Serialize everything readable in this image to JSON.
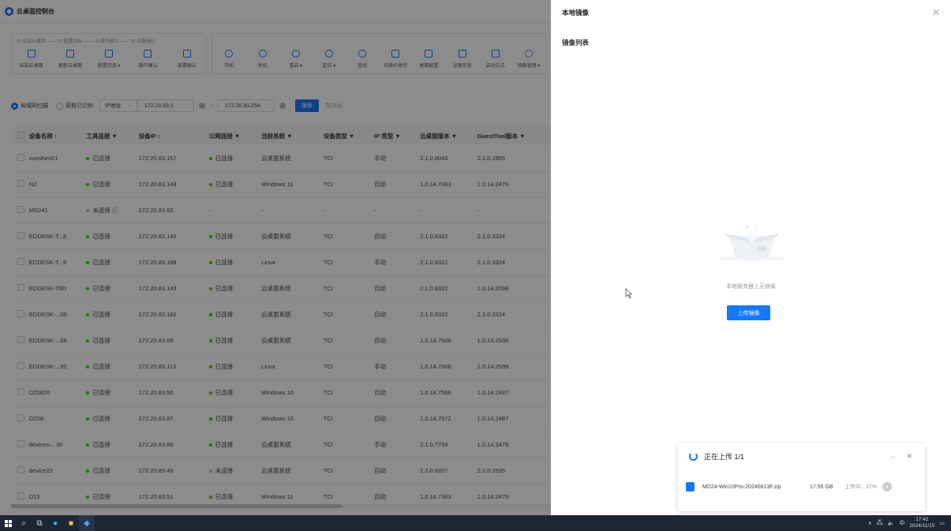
{
  "app": {
    "title": "云桌面控制台"
  },
  "steps": "① 安装云桌面 —— ② 配置目标 —— ③ 操作确认 —— ④ 部署确认",
  "toolbar": [
    {
      "label": "安装云桌面",
      "icon": "install-icon"
    },
    {
      "label": "更新云桌面",
      "icon": "update-icon"
    },
    {
      "label": "配置信息 ▾",
      "icon": "config-icon"
    },
    {
      "label": "操作确认",
      "icon": "confirm-icon"
    },
    {
      "label": "部署确认",
      "icon": "deploy-icon"
    },
    {
      "label": "开机",
      "icon": "power-on-icon"
    },
    {
      "label": "关机",
      "icon": "power-off-icon"
    },
    {
      "label": "重启 ▾",
      "icon": "restart-icon"
    },
    {
      "label": "定位 ▾",
      "icon": "locate-icon"
    },
    {
      "label": "查找",
      "icon": "search-icon"
    },
    {
      "label": "切换IP类型",
      "icon": "switch-ip-icon"
    },
    {
      "label": "桌面配置",
      "icon": "desktop-config-icon"
    },
    {
      "label": "设备信息",
      "icon": "device-info-icon"
    },
    {
      "label": "启动方式",
      "icon": "boot-mode-icon"
    },
    {
      "label": "镜像管理 ▾",
      "icon": "image-manage-icon"
    }
  ],
  "filter": {
    "radio1": "局域网扫描",
    "radio2": "获取已识别",
    "select": "IP地址",
    "from": "172.20.83.1",
    "sep": "~",
    "to": "172.20.83.254",
    "search": "搜索",
    "count": "共15台"
  },
  "table": {
    "headers": [
      "设备名称 ↕",
      "工具连接 ▼",
      "设备IP ↕",
      "公网连接 ▼",
      "当前系统 ▼",
      "设备类型 ▼",
      "IP 类型 ▼",
      "云桌面版本 ▼",
      "GuestTool版本 ▼"
    ],
    "rows": [
      [
        "xueshen01",
        "已连接",
        "172.20.83.157",
        "已连接",
        "云桌面系统",
        "TCI",
        "手动",
        "2.1.0.8043",
        "2.1.0.2855"
      ],
      [
        "N2",
        "已连接",
        "172.20.83.148",
        "已连接",
        "Windows 11",
        "TCI",
        "自动",
        "1.0.14.7363",
        "1.0.14.2479"
      ],
      [
        "MD241",
        "未连接 ⓘ",
        "172.20.83.63",
        "-",
        "-",
        "-",
        "-",
        "-",
        "-"
      ],
      [
        "EDDESK-T...6",
        "已连接",
        "172.20.83.145",
        "已连接",
        "云桌面系统",
        "TCI",
        "自动",
        "2.1.0.8322",
        "2.1.0.3324"
      ],
      [
        "EDDESK-T...6",
        "已连接",
        "172.20.83.188",
        "已连接",
        "Linux",
        "TCI",
        "手动",
        "2.1.0.8322",
        "2.1.0.3324"
      ],
      [
        "EDDESK-T8D",
        "已连接",
        "172.20.83.143",
        "已连接",
        "云桌面系统",
        "TCI",
        "自动",
        "2.1.0.8322",
        "1.0.14.2598"
      ],
      [
        "EDDESK-...00",
        "已连接",
        "172.20.83.160",
        "已连接",
        "云桌面系统",
        "TCI",
        "自动",
        "2.1.0.8322",
        "2.1.0.3324"
      ],
      [
        "EDDESK-...68",
        "已连接",
        "172.20.83.69",
        "已连接",
        "云桌面系统",
        "TCI",
        "自动",
        "1.0.14.7606",
        "1.0.14.2598"
      ],
      [
        "EDDESK-...92",
        "已连接",
        "172.20.83.113",
        "已连接",
        "Linux",
        "TCI",
        "手动",
        "1.0.14.7606",
        "1.0.14.2598"
      ],
      [
        "DZ0826",
        "已连接",
        "172.20.83.50",
        "已连接",
        "Windows 10",
        "TCI",
        "自动",
        "1.0.14.7566",
        "1.0.14.2487"
      ],
      [
        "DZ08",
        "已连接",
        "172.20.83.87",
        "已连接",
        "Windows 10",
        "TCI",
        "自动",
        "1.0.14.7572",
        "1.0.14.2487"
      ],
      [
        "devices-...30",
        "已连接",
        "172.20.83.88",
        "已连接",
        "云桌面系统",
        "TCI",
        "手动",
        "2.1.0.7759",
        "1.0.14.2479"
      ],
      [
        "device22",
        "已连接",
        "172.20.83.49",
        "未连接",
        "云桌面系统",
        "TCI",
        "自动",
        "2.2.0.8207",
        "2.2.0.2935"
      ],
      [
        "D15",
        "已连接",
        "172.20.83.51",
        "已连接",
        "Windows 11",
        "TCI",
        "自动",
        "1.0.14.7363",
        "1.0.14.2479"
      ]
    ]
  },
  "drawer": {
    "title": "本地镜像",
    "subtitle": "镜像列表",
    "empty_text": "本地服务器上无镜像",
    "upload_button": "上传镜像"
  },
  "upload": {
    "title": "正在上传 1/1",
    "file_name": "MD24-Win10Pro-20240813F.zip",
    "size": "17.55 GB",
    "status": "上传中...37%",
    "progress_percent": 37
  },
  "taskbar": {
    "time": "17:42",
    "date": "2024/11/15",
    "ime": "中"
  },
  "colors": {
    "accent": "#1677ff",
    "online": "#52c41a",
    "offline": "#bbbbbb"
  }
}
